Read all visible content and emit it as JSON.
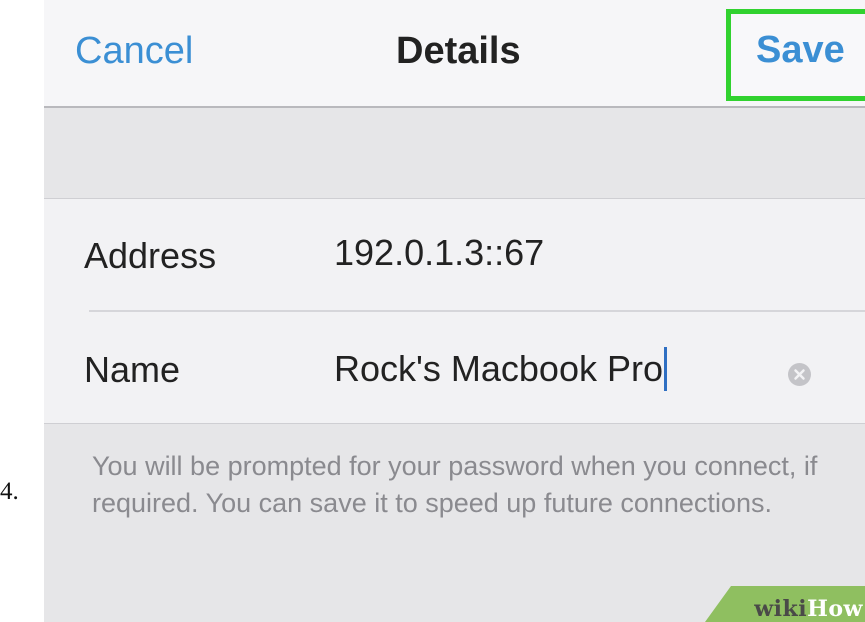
{
  "step": {
    "number": "4."
  },
  "nav": {
    "cancel_label": "Cancel",
    "title": "Details",
    "save_label": "Save"
  },
  "form": {
    "address": {
      "label": "Address",
      "value": "192.0.1.3::67"
    },
    "name": {
      "label": "Name",
      "value": "Rock's Macbook Pro"
    }
  },
  "footer_note": "You will be prompted for your password when you connect, if required. You can save it to speed up future connections.",
  "watermark": {
    "wiki": "wiki",
    "how": "How"
  },
  "colors": {
    "accent": "#3b8fd4",
    "highlight": "#31d22f",
    "watermark_green": "#8fbf60"
  }
}
